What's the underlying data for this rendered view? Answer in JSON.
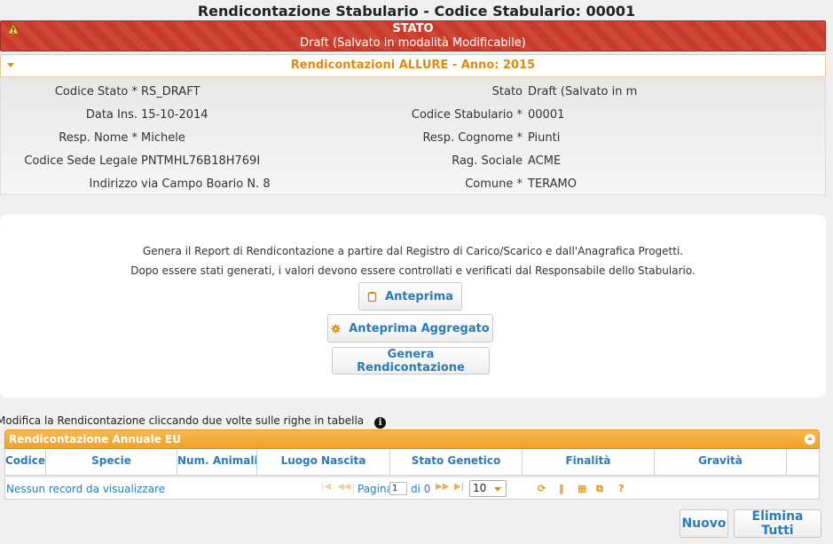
{
  "page": {
    "title": "Rendicontazione Stabulario - Codice Stabulario: 00001"
  },
  "status": {
    "title": "STATO",
    "description": "Draft (Salvato in modalità Modificabile)"
  },
  "section": {
    "title": "Rendicontazioni ALLURE - Anno: 2015"
  },
  "info": {
    "rows": [
      {
        "left_label": "Codice Stato *",
        "left_value": "RS_DRAFT",
        "right_label": "Stato",
        "right_value": "Draft (Salvato in m"
      },
      {
        "left_label": "Data Ins.",
        "left_value": "15-10-2014",
        "right_label": "Codice Stabulario *",
        "right_value": "00001"
      },
      {
        "left_label": "Resp. Nome *",
        "left_value": "Michele",
        "right_label": "Resp. Cognome *",
        "right_value": "Piunti"
      },
      {
        "left_label": "Codice Sede Legale",
        "left_value": "PNTMHL76B18H769I",
        "right_label": "Rag. Sociale",
        "right_value": "ACME"
      },
      {
        "left_label": "Indirizzo",
        "left_value": "via Campo Boario N. 8",
        "right_label": "Comune *",
        "right_value": "TERAMO"
      }
    ]
  },
  "generate": {
    "line1": "Genera il Report di Rendicontazione a partire dal Registro di Carico/Scarico e dall'Anagrafica Progetti.",
    "line2": "Dopo essere stati generati, i valori devono essere controllati e verificati dal Responsabile dello Stabulario.",
    "preview_label": "Anteprima",
    "preview_aggregate_label": "Anteprima Aggregato",
    "generate_label": "Genera Rendicontazione"
  },
  "hint": {
    "text": "Modifica la Rendicontazione cliccando due volte sulle righe in tabella"
  },
  "grid": {
    "title": "Rendicontazione Annuale EU",
    "columns": [
      "Codice",
      "Specie",
      "Num. Animali",
      "Luogo Nascita",
      "Stato Genetico",
      "Finalità",
      "Gravità"
    ],
    "empty_text": "Nessun record da visualizzare",
    "page_label": "Pagina",
    "page_value": "1",
    "of_label": "di 0",
    "rows_per_page": "10"
  },
  "actions": {
    "new_label": "Nuovo",
    "delete_all_label": "Elimina Tutti"
  },
  "colors": {
    "danger": "#c93a2a",
    "accent": "#e08a0b",
    "link": "#2c7bb6",
    "grid_header": "#f0a22a"
  }
}
